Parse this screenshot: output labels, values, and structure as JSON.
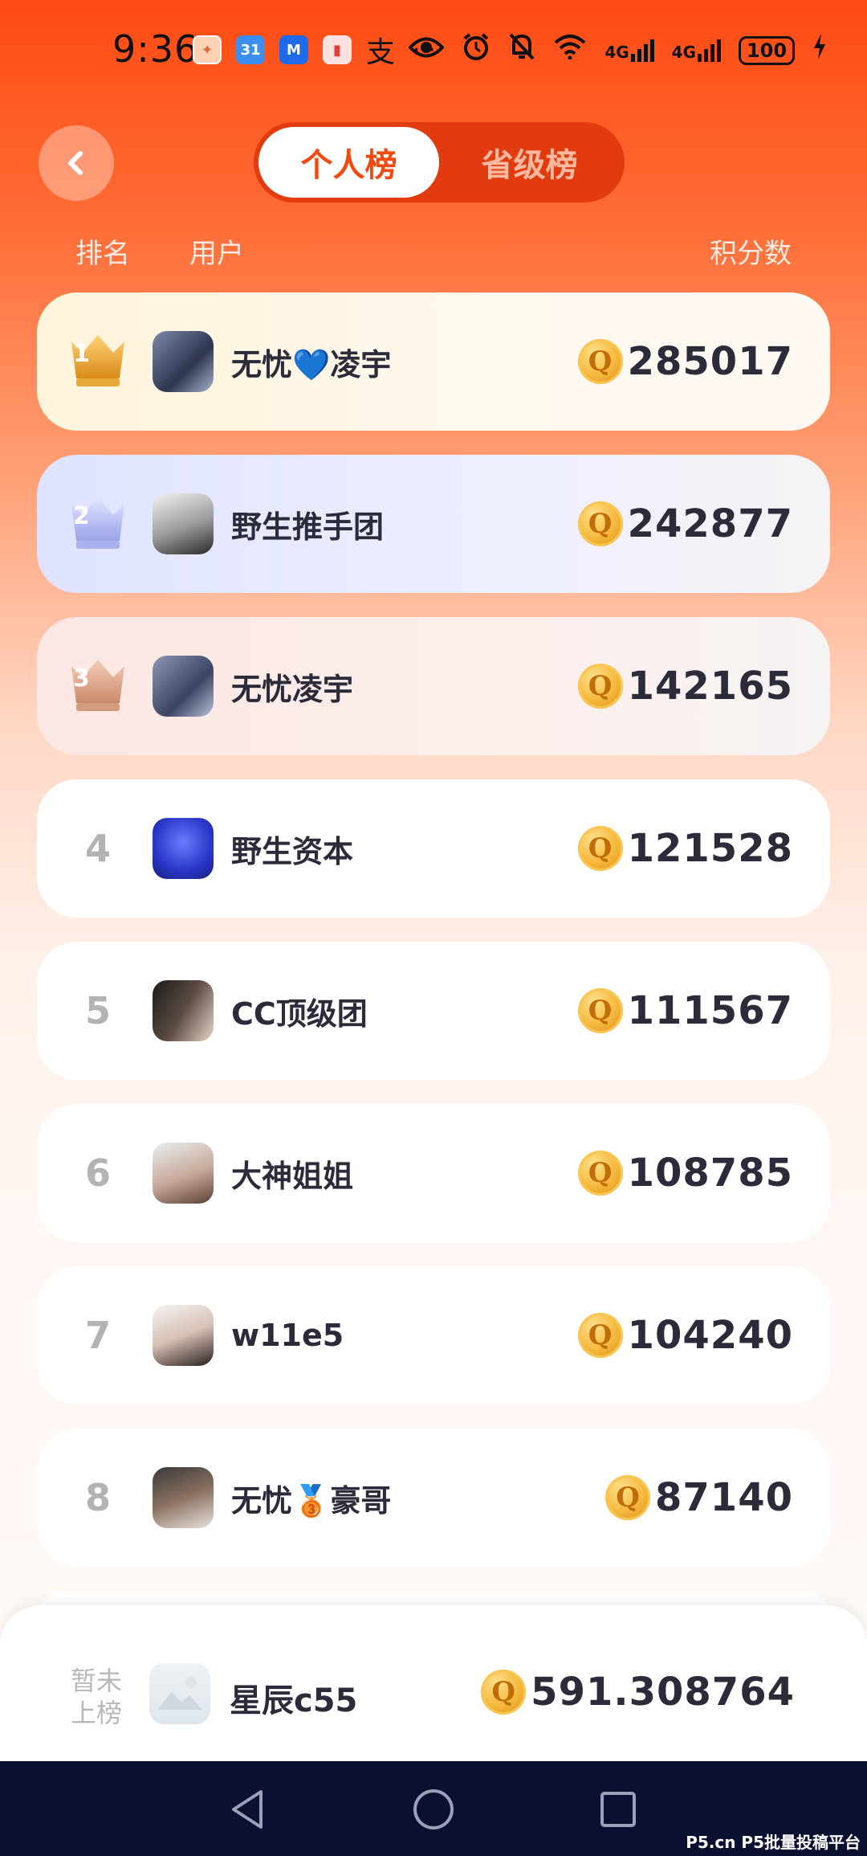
{
  "status_bar": {
    "time": "9:36",
    "app_icons": [
      "app-notification-icon",
      "calendar-icon",
      "mail-icon",
      "reader-icon",
      "alipay-icon"
    ],
    "calendar_day": "31",
    "alipay_glyph": "支",
    "more": "···",
    "network_label_1": "4G",
    "network_label_2": "4G",
    "battery": "100"
  },
  "header": {
    "tabs": [
      {
        "label": "个人榜",
        "active": true
      },
      {
        "label": "省级榜",
        "active": false
      }
    ]
  },
  "columns": {
    "rank": "排名",
    "user": "用户",
    "score": "积分数"
  },
  "leaderboard": [
    {
      "rank": "1",
      "name": "无忧💙凌宇",
      "score": "285017"
    },
    {
      "rank": "2",
      "name": "野生推手团",
      "score": "242877"
    },
    {
      "rank": "3",
      "name": "无忧凌宇",
      "score": "142165"
    },
    {
      "rank": "4",
      "name": "野生资本",
      "score": "121528"
    },
    {
      "rank": "5",
      "name": "CC顶级团",
      "score": "111567"
    },
    {
      "rank": "6",
      "name": "大神姐姐",
      "score": "108785"
    },
    {
      "rank": "7",
      "name": "w11e5",
      "score": "104240"
    },
    {
      "rank": "8",
      "name": "无忧🥉豪哥",
      "score": "87140"
    }
  ],
  "coin_glyph": "Q",
  "my_entry": {
    "rank_label": "暂未上榜",
    "name": "星辰c55",
    "score": "591.308764"
  },
  "watermark": "P5.cn P5批量投稿平台",
  "colors": {
    "accent": "#f04a10",
    "header_top": "#ff4a14",
    "text_dark": "#2b2b3a",
    "gold": "#f5b73a",
    "nav_bg": "#0b1030"
  }
}
